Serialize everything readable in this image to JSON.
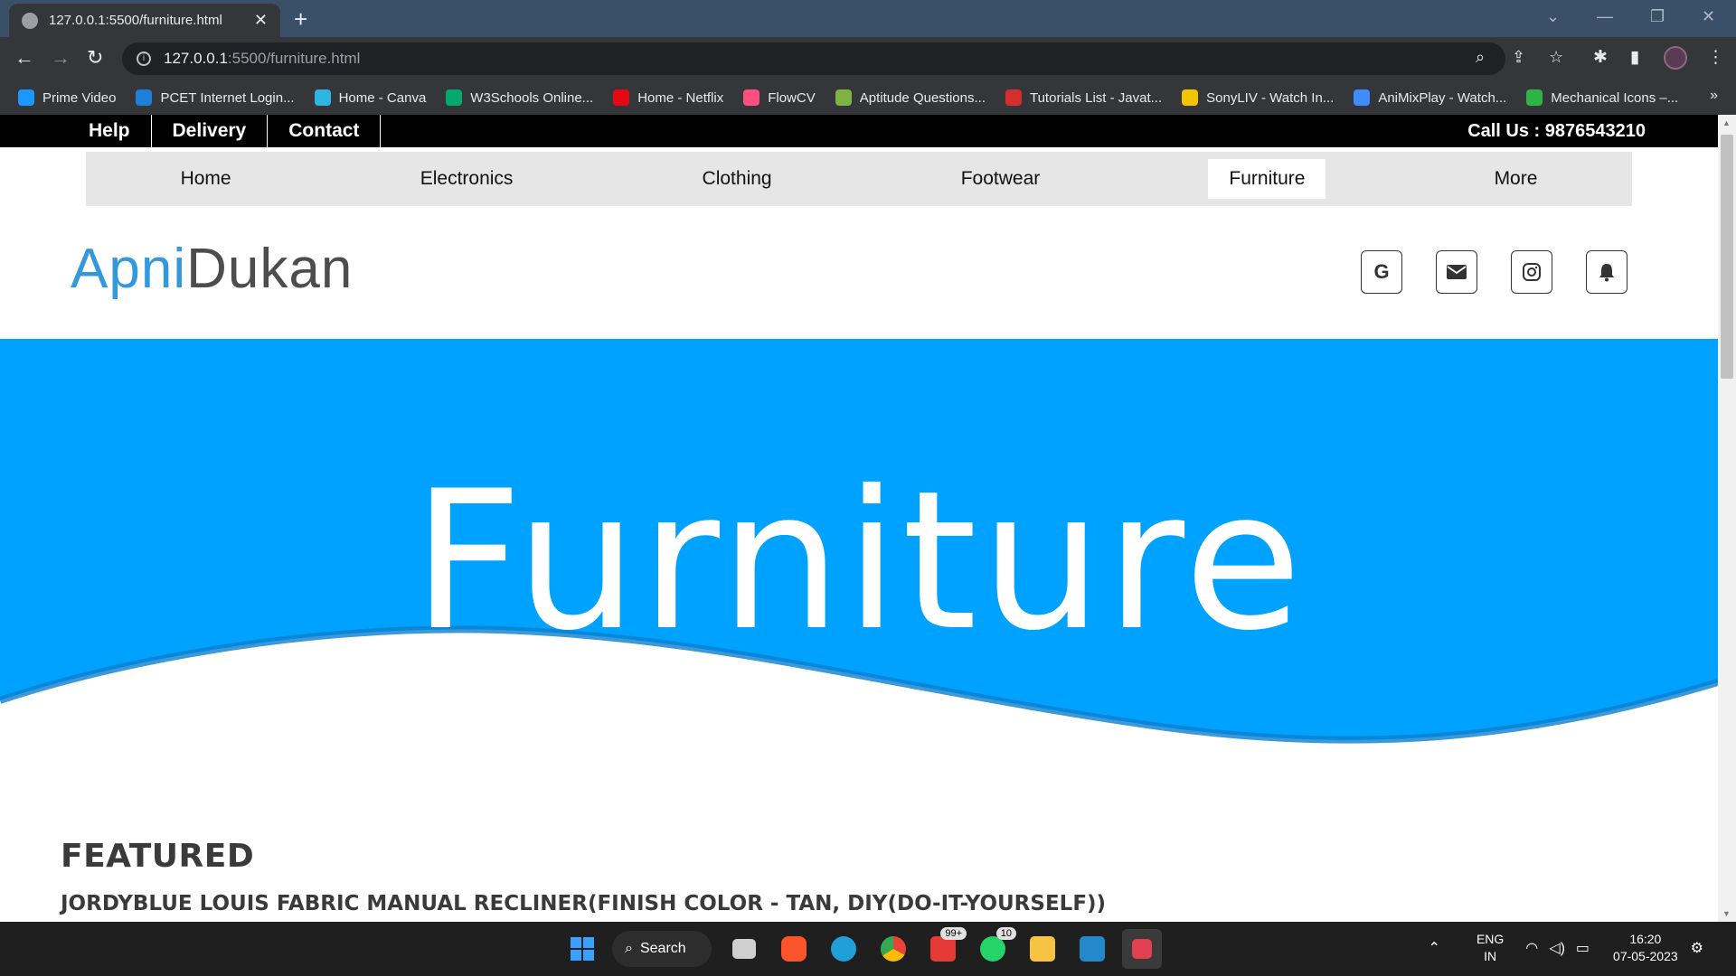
{
  "browser": {
    "tab_title": "127.0.0.1:5500/furniture.html",
    "url_host": "127.0.0.1",
    "url_path": ":5500/furniture.html",
    "bookmarks": [
      {
        "label": "Prime Video",
        "color": "#1a98ff"
      },
      {
        "label": "PCET Internet Login...",
        "color": "#1e7fd8"
      },
      {
        "label": "Home - Canva",
        "color": "#2fb5e0"
      },
      {
        "label": "W3Schools Online...",
        "color": "#04aa6d"
      },
      {
        "label": "Home - Netflix",
        "color": "#e50914"
      },
      {
        "label": "FlowCV",
        "color": "#ff4f81"
      },
      {
        "label": "Aptitude Questions...",
        "color": "#7cb342"
      },
      {
        "label": "Tutorials List - Javat...",
        "color": "#d32f2f"
      },
      {
        "label": "SonyLIV - Watch In...",
        "color": "#f5c400"
      },
      {
        "label": "AniMixPlay - Watch...",
        "color": "#3f8cff"
      },
      {
        "label": "Mechanical Icons –...",
        "color": "#2fb344"
      }
    ]
  },
  "topbar": {
    "links": [
      "Help",
      "Delivery",
      "Contact"
    ],
    "call": "Call Us : 9876543210"
  },
  "nav": {
    "items": [
      "Home",
      "Electronics",
      "Clothing",
      "Footwear",
      "Furniture",
      "More"
    ],
    "active": "Furniture"
  },
  "brand": {
    "part1": "Apni",
    "part2": "Dukan"
  },
  "social": {
    "google": "G"
  },
  "hero": {
    "title": "Furniture",
    "color": "#00a2ff"
  },
  "featured": {
    "heading": "Featured",
    "product": "JordyBlue Louis Fabric Manual Recliner(Finish Color - Tan, DIY(Do-It-Yourself))"
  },
  "taskbar": {
    "search_label": "Search",
    "mail_badge": "99+",
    "whatsapp_badge": "10",
    "lang_1": "ENG",
    "lang_2": "IN",
    "time": "16:20",
    "date": "07-05-2023"
  }
}
